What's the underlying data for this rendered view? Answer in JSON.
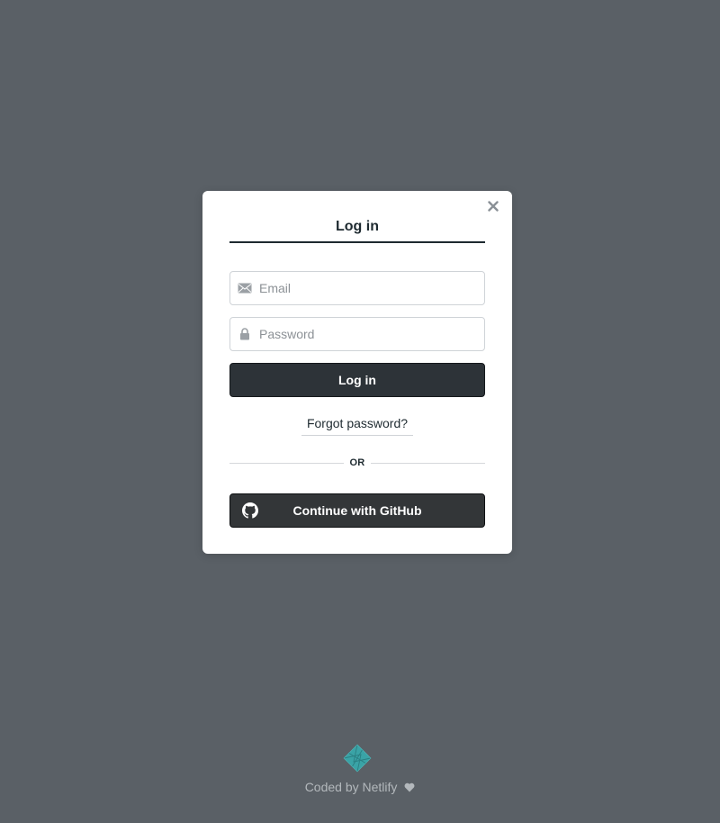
{
  "modal": {
    "title": "Log in",
    "close_label": "×"
  },
  "form": {
    "email": {
      "placeholder": "Email",
      "value": "",
      "icon": "envelope-icon"
    },
    "password": {
      "placeholder": "Password",
      "value": "",
      "icon": "lock-icon"
    },
    "login_button": "Log in",
    "forgot_link": "Forgot password?",
    "divider": "OR",
    "github_button": "Continue with GitHub",
    "github_icon": "github-icon"
  },
  "footer": {
    "text": "Coded by Netlify",
    "icon": "heart-icon",
    "logo": "netlify-logo-icon"
  },
  "colors": {
    "backdrop": "#5a6066",
    "login_button": "#2d3338",
    "github_button": "#333638",
    "logo": "#3aa3a6"
  }
}
